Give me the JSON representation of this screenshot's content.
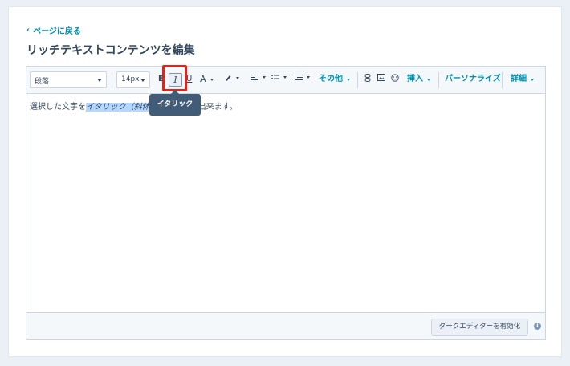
{
  "nav": {
    "back_label": "ページに戻る"
  },
  "page": {
    "title": "リッチテキストコンテンツを編集"
  },
  "toolbar": {
    "paragraph_select": "段落",
    "font_size_select": "14px",
    "bold": "B",
    "italic": "I",
    "underline": "U",
    "text_color": "A",
    "more_label": "その他",
    "insert_label": "挿入",
    "personalize_label": "パーソナライズ",
    "details_label": "詳細"
  },
  "tooltip": {
    "text": "イタリック"
  },
  "content": {
    "before": "選択した文字を",
    "selected": "イタリック（斜体）",
    "after": "出来ます。"
  },
  "footer": {
    "dark_editor_button": "ダークエディターを有効化"
  },
  "colors": {
    "accent": "#0091ae",
    "highlight_box": "#e3231b",
    "tooltip_bg": "#425b76",
    "selection": "#b4d7ff"
  }
}
